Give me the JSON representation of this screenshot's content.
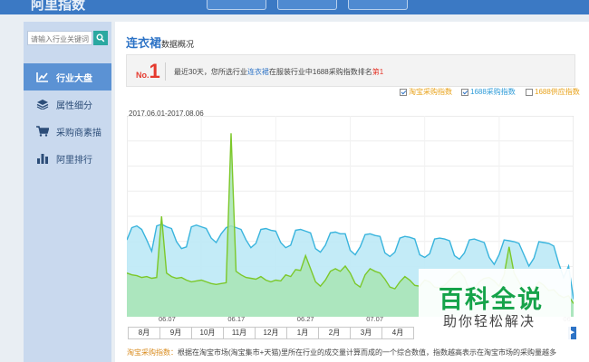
{
  "header": {
    "logo_text": "阿里指数"
  },
  "sidebar": {
    "search_placeholder": "请输入行业关键词",
    "items": [
      {
        "label": "行业大盘",
        "icon": "chart-icon",
        "active": true
      },
      {
        "label": "属性细分",
        "icon": "layers-icon",
        "active": false
      },
      {
        "label": "采购商素描",
        "icon": "cart-icon",
        "active": false
      },
      {
        "label": "阿里排行",
        "icon": "bar-chart-icon",
        "active": false
      }
    ]
  },
  "main": {
    "category": "连衣裙",
    "category_suffix": "数据概况",
    "rank": {
      "prefix": "No.",
      "number": "1",
      "text_before": "最近30天，您所选行业",
      "text_category": "连衣裙",
      "text_middle": "在服装行业中1688采购指数排名",
      "text_rank": "第1"
    },
    "date_range": "2017.06.01-2017.08.06",
    "legend": [
      {
        "label": "淘宝采购指数",
        "checked": true,
        "color": "#e8a21a"
      },
      {
        "label": "1688采购指数",
        "checked": true,
        "color": "#2d9bd8"
      },
      {
        "label": "1688供应指数",
        "checked": false,
        "color": "#e8a21a"
      }
    ],
    "months": [
      "8月",
      "9月",
      "10月",
      "11月",
      "12月",
      "1月",
      "2月",
      "3月",
      "4月"
    ],
    "description_key": "淘宝采购指数：",
    "description": "根据在淘宝市场(淘宝集市+天猫)里所在行业的成交量计算而成的一个综合数值，指数越高表示在淘宝市场的采购量越多"
  },
  "chart_data": {
    "type": "area",
    "x_tick_labels": [
      "06.07",
      "06.17",
      "06.27",
      "07.07",
      "06"
    ],
    "series": [
      {
        "name": "1688采购指数",
        "color": "#39b4dd",
        "fill": "#bde9f6",
        "values": [
          88,
          102,
          104,
          100,
          88,
          75,
          104,
          106,
          103,
          101,
          86,
          78,
          80,
          103,
          105,
          103,
          101,
          90,
          85,
          95,
          102,
          104,
          102,
          100,
          88,
          79,
          84,
          100,
          101,
          99,
          98,
          85,
          79,
          82,
          99,
          100,
          98,
          96,
          78,
          74,
          82,
          96,
          97,
          95,
          95,
          76,
          71,
          80,
          94,
          95,
          93,
          92,
          73,
          69,
          74,
          90,
          92,
          91,
          89,
          71,
          68,
          72,
          89,
          90,
          89,
          87,
          70,
          66,
          73,
          88,
          89,
          87,
          85,
          68,
          60,
          71,
          88,
          87,
          86,
          84,
          71,
          58,
          67,
          86,
          85,
          84,
          81,
          61,
          45,
          58,
          20
        ]
      },
      {
        "name": "淘宝采购指数",
        "color": "#7cc82a",
        "fill": "#a8e5b4",
        "values": [
          50,
          48,
          47,
          45,
          46,
          44,
          45,
          115,
          50,
          46,
          44,
          45,
          42,
          40,
          41,
          42,
          40,
          38,
          37,
          38,
          39,
          210,
          52,
          48,
          45,
          44,
          43,
          46,
          42,
          40,
          42,
          41,
          48,
          46,
          54,
          53,
          70,
          55,
          40,
          35,
          42,
          52,
          55,
          52,
          58,
          50,
          38,
          34,
          48,
          55,
          52,
          50,
          43,
          34,
          32,
          40,
          46,
          42,
          36,
          35,
          42,
          40,
          34,
          33,
          36,
          42,
          48,
          52,
          45,
          30,
          32,
          40,
          44,
          45,
          41,
          35,
          48,
          80,
          50,
          40,
          30,
          28,
          32,
          40,
          36,
          30,
          31,
          25,
          22,
          24,
          15
        ]
      }
    ],
    "ylim": [
      0,
      230
    ],
    "grid": true
  }
}
